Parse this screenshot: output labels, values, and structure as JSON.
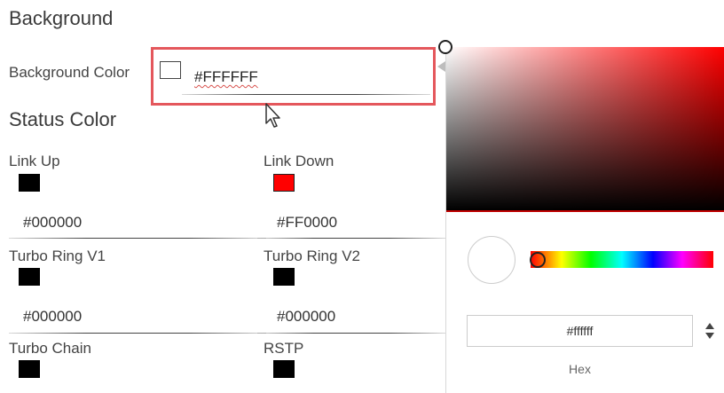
{
  "background": {
    "title": "Background",
    "color_label": "Background Color",
    "color_value": "#FFFFFF",
    "swatch_color": "#ffffff"
  },
  "status": {
    "title": "Status Color",
    "items": [
      {
        "label": "Link Up",
        "value": "#000000",
        "swatch_color": "#000000"
      },
      {
        "label": "Link Down",
        "value": "#FF0000",
        "swatch_color": "#ff0000"
      },
      {
        "label": "Turbo Ring V1",
        "value": "#000000",
        "swatch_color": "#000000"
      },
      {
        "label": "Turbo Ring V2",
        "value": "#000000",
        "swatch_color": "#000000"
      },
      {
        "label": "Turbo Chain",
        "swatch_color": "#000000"
      },
      {
        "label": "RSTP",
        "swatch_color": "#000000"
      }
    ]
  },
  "picker": {
    "hue_color": "#ff0000",
    "hex_value": "#ffffff",
    "hex_label": "Hex",
    "preview_color": "#ffffff",
    "format_toggle_icon": "up-down-arrows-icon"
  },
  "colors": {
    "highlight": "#e4575c"
  }
}
